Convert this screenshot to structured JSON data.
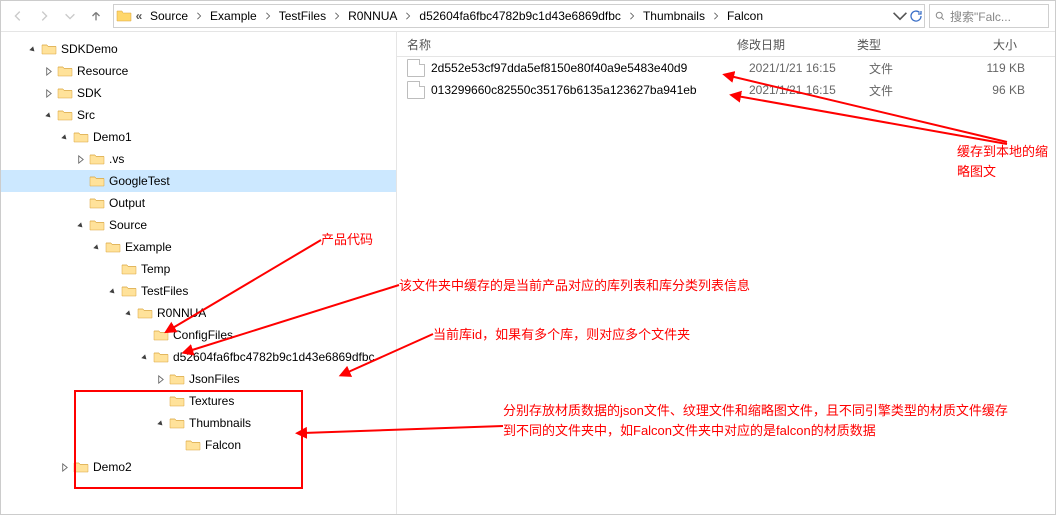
{
  "breadcrumbs": [
    "Source",
    "Example",
    "TestFiles",
    "R0NNUA",
    "d52604fa6fbc4782b9c1d43e6869dfbc",
    "Thumbnails",
    "Falcon"
  ],
  "search_placeholder": "搜索\"Falc...",
  "columns": {
    "name": "名称",
    "date": "修改日期",
    "type": "类型",
    "size": "大小"
  },
  "tree": [
    {
      "d": 1,
      "exp": "open",
      "label": "SDKDemo"
    },
    {
      "d": 2,
      "exp": "closed",
      "label": "Resource"
    },
    {
      "d": 2,
      "exp": "closed",
      "label": "SDK"
    },
    {
      "d": 2,
      "exp": "open",
      "label": "Src"
    },
    {
      "d": 3,
      "exp": "open",
      "label": "Demo1"
    },
    {
      "d": 4,
      "exp": "closed",
      "label": ".vs"
    },
    {
      "d": 4,
      "exp": "none",
      "label": "GoogleTest",
      "sel": true
    },
    {
      "d": 4,
      "exp": "none",
      "label": "Output"
    },
    {
      "d": 4,
      "exp": "open",
      "label": "Source"
    },
    {
      "d": 5,
      "exp": "open",
      "label": "Example"
    },
    {
      "d": 6,
      "exp": "none",
      "label": "Temp"
    },
    {
      "d": 6,
      "exp": "open",
      "label": "TestFiles"
    },
    {
      "d": 7,
      "exp": "open",
      "label": "R0NNUA"
    },
    {
      "d": 8,
      "exp": "none",
      "label": "ConfigFiles"
    },
    {
      "d": 8,
      "exp": "open",
      "label": "d52604fa6fbc4782b9c1d43e6869dfbc"
    },
    {
      "d": 9,
      "exp": "closed",
      "label": "JsonFiles"
    },
    {
      "d": 9,
      "exp": "none",
      "label": "Textures"
    },
    {
      "d": 9,
      "exp": "open",
      "label": "Thumbnails"
    },
    {
      "d": 10,
      "exp": "none",
      "label": "Falcon",
      "leaf": true
    },
    {
      "d": 3,
      "exp": "closed",
      "label": "Demo2"
    }
  ],
  "files": [
    {
      "name": "2d552e53cf97dda5ef8150e80f40a9e5483e40d9",
      "date": "2021/1/21 16:15",
      "type": "文件",
      "size": "119 KB"
    },
    {
      "name": "013299660c82550c35176b6135a123627ba941eb",
      "date": "2021/1/21 16:15",
      "type": "文件",
      "size": "96 KB"
    }
  ],
  "annotations": {
    "a1": "产品代码",
    "a2": "该文件夹中缓存的是当前产品对应的库列表和库分类列表信息",
    "a3": "当前库id，如果有多个库，则对应多个文件夹",
    "a4": "分别存放材质数据的json文件、纹理文件和缩略图文件，且不同引擎类型的材质文件缓存到不同的文件夹中，如Falcon文件夹中对应的是falcon的材质数据",
    "a5": "缓存到本地的缩略图文"
  }
}
